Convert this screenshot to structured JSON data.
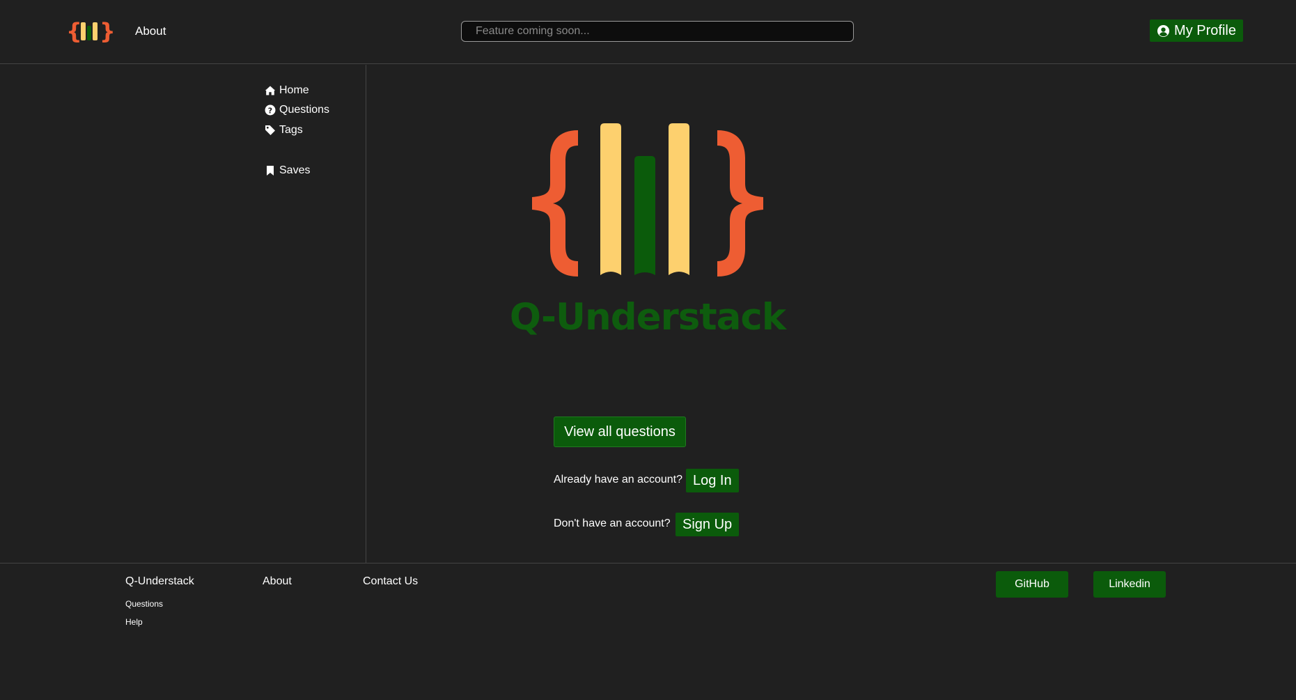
{
  "colors": {
    "background": "#202020",
    "accent_green": "#0b5b0b",
    "logo_orange": "#ee5d33",
    "logo_yellow": "#fdd06e",
    "logo_dark_green": "#0b5b0b"
  },
  "header": {
    "logo_icon": "q-understack-logo",
    "about_link": "About",
    "search_placeholder": "Feature coming soon...",
    "profile_button": "My Profile",
    "profile_icon": "user-circle-icon"
  },
  "sidebar": {
    "items": [
      {
        "label": "Home",
        "icon": "home-icon"
      },
      {
        "label": "Questions",
        "icon": "question-circle-icon"
      },
      {
        "label": "Tags",
        "icon": "tag-icon"
      },
      {
        "label": "Saves",
        "icon": "bookmark-icon"
      }
    ]
  },
  "main": {
    "title": "Q-Understack",
    "view_all_button": "View all questions",
    "login_prompt": "Already have an account?",
    "login_button": "Log In",
    "signup_prompt": "Don't have an account?",
    "signup_button": "Sign Up"
  },
  "footer": {
    "brand": "Q-Understack",
    "brand_links": [
      "Questions",
      "Help"
    ],
    "about": "About",
    "contact": "Contact Us",
    "github_button": "GitHub",
    "linkedin_button": "Linkedin"
  }
}
